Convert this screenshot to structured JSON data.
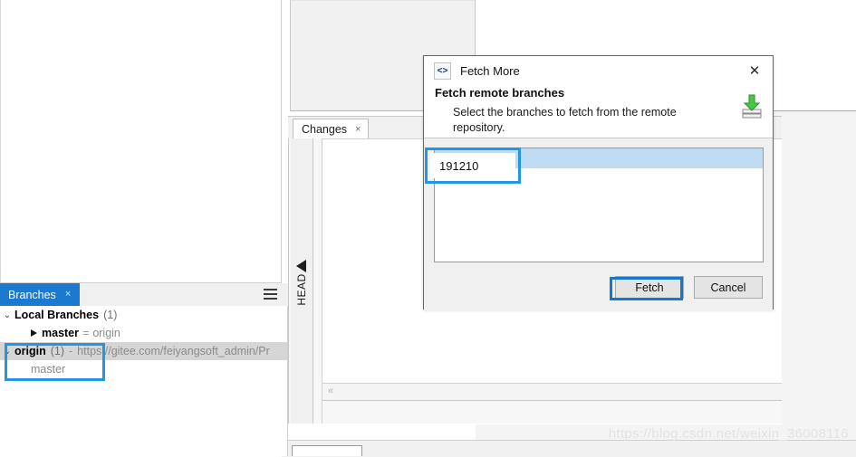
{
  "panels": {
    "changes_tab": {
      "label": "Changes",
      "close": "×"
    },
    "head_gutter": {
      "label": "HEAD"
    },
    "hscroll_arrow": "«"
  },
  "branches_panel": {
    "tab": {
      "label": "Branches",
      "close": "×"
    },
    "menu_icon": "hamburger-menu-icon",
    "tree": [
      {
        "chevron": "⌄",
        "label": "Local Branches",
        "count": "(1)",
        "bold": true,
        "level": 1,
        "selected": false
      },
      {
        "arrow": "▶",
        "label": "master",
        "equals": "=",
        "remote": "origin",
        "bold": true,
        "level": 2,
        "selected": false
      },
      {
        "chevron": "⌄",
        "label": "origin",
        "count": "(1)",
        "dash": "-",
        "url": "https://gitee.com/feiyangsoft_admin/Pr",
        "bold": true,
        "level": 1,
        "selected": true
      },
      {
        "label": "master",
        "muted": true,
        "level": 3,
        "selected": false
      }
    ]
  },
  "dialog": {
    "icon": "code-brackets-icon",
    "title": "Fetch More",
    "close_label": "✕",
    "heading": "Fetch remote branches",
    "description": "Select the branches to fetch from the remote repository.",
    "header_icon": "fetch-download-icon",
    "list": {
      "items": [
        {
          "label": "191210",
          "selected": true
        }
      ]
    },
    "buttons": {
      "fetch": "Fetch",
      "cancel": "Cancel"
    }
  },
  "annotations": {
    "accent_color": "#2196e3",
    "highlight_color": "#1478d2"
  },
  "watermark": {
    "text": "https://blog.csdn.net/weixin_36008116"
  }
}
